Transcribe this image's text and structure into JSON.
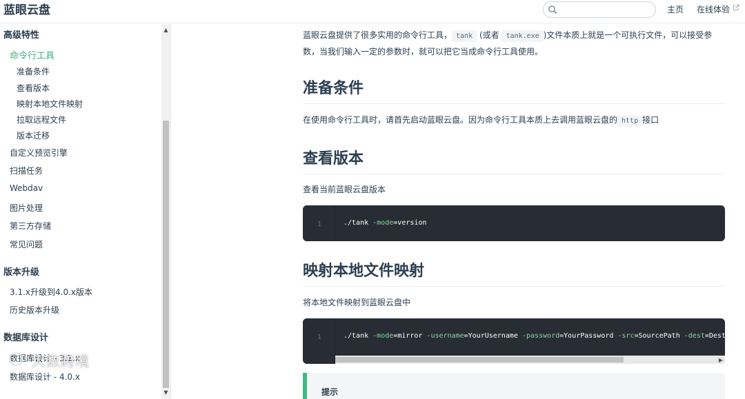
{
  "header": {
    "site_name": "蓝眼云盘",
    "search_placeholder": "",
    "nav_home": "主页",
    "nav_demo": "在线体验"
  },
  "sidebar": {
    "section1": "高级特性",
    "active_item": "命令行工具",
    "sub_items": [
      "准备条件",
      "查看版本",
      "映射本地文件映射",
      "拉取远程文件",
      "版本迁移"
    ],
    "items": [
      "自定义预览引擎",
      "扫描任务",
      "Webdav",
      "图片处理",
      "第三方存储",
      "常见问题"
    ],
    "section2": "版本升级",
    "upgrade_items": [
      "3.1.x升级到4.0.x版本",
      "历史版本升级"
    ],
    "section3": "数据库设计",
    "db_items": [
      "数据库设计 - 3.1.x",
      "数据库设计 - 4.0.x"
    ]
  },
  "watermark": "大数跨境",
  "content": {
    "intro_1": "蓝眼云盘提供了很多实用的命令行工具，",
    "code_tank": "tank",
    "intro_2": "(或者",
    "code_tank_exe": "tank.exe",
    "intro_3": ")文件本质上就是一个可执行文件，可以接受参数，当我们输入一定的参数时，就可以把它当成命令行工具使用。",
    "h_prepare": "准备条件",
    "prepare_1": "在使用命令行工具时，请首先启动蓝眼云盘。因为命令行工具本质上去调用蓝眼云盘的",
    "code_http": "http",
    "prepare_2": "接口",
    "h_version": "查看版本",
    "version_text": "查看当前蓝眼云盘版本",
    "code1_line": "1",
    "code1": {
      "cmd": "./tank ",
      "flag": "-mode",
      "eq": "=",
      "val": "version"
    },
    "h_mirror": "映射本地文件映射",
    "mirror_text": "将本地文件映射到蓝眼云盘中",
    "code2_line": "1",
    "code2": {
      "cmd": "./tank ",
      "f1": "-mode",
      "v1": "=mirror ",
      "f2": "-username",
      "v2": "=YourUsername ",
      "f3": "-password",
      "v3": "=YourPassword ",
      "f4": "-src",
      "v4": "=SourcePath ",
      "f5": "-dest",
      "v5": "=DestPath"
    },
    "tip_title": "提示"
  },
  "colors": {
    "accent": "#3eaf7c",
    "code_bg": "#282c34",
    "tip_border": "#42b983"
  }
}
